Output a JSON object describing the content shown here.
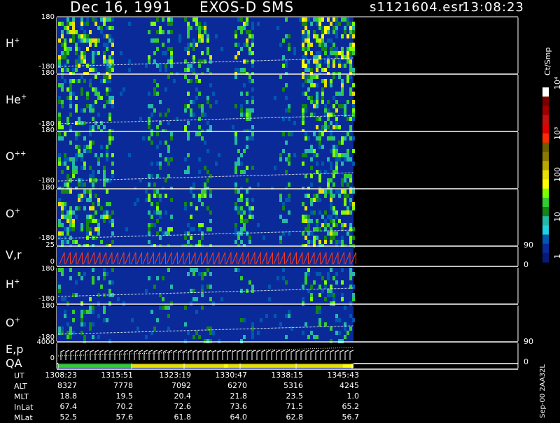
{
  "header": {
    "date": "Dec 16, 1991",
    "instrument": "EXOS-D SMS",
    "file": "s1121604.esr",
    "time": "13:08:23"
  },
  "colorbar": {
    "unit_label": "Ct/Smp",
    "ticks": [
      "10⁴",
      "10³",
      "100",
      "10",
      "1"
    ],
    "colors": [
      "#ffffff",
      "#7a0000",
      "#a00000",
      "#c01010",
      "#e00000",
      "#ff2a00",
      "#6b5d00",
      "#8a7a00",
      "#b8a800",
      "#e8e000",
      "#ffff00",
      "#7cff00",
      "#33cc33",
      "#158515",
      "#25b8a8",
      "#20d0e0",
      "#0058b0",
      "#0a2a9a",
      "#061a7a"
    ],
    "colors_role": "colour scale from top (high counts) to bottom (low counts)"
  },
  "panels": [
    {
      "id": "h_plus_1",
      "label": "H",
      "sup": "+",
      "ymax": "180",
      "ymin": "-180"
    },
    {
      "id": "he_plus",
      "label": "He",
      "sup": "+",
      "ymax": "180",
      "ymin": "-180"
    },
    {
      "id": "o_plusplus",
      "label": "O",
      "sup": "++",
      "ymax": "180",
      "ymin": "-180"
    },
    {
      "id": "o_plus_1",
      "label": "O",
      "sup": "+",
      "ymax": "180",
      "ymin": "-180"
    },
    {
      "id": "vr",
      "label": "V,r",
      "ymax": "25",
      "ymin": "0",
      "rmax": "90",
      "rmin": "0"
    },
    {
      "id": "h_plus_2",
      "label": "H",
      "sup": "+",
      "ymax": "180",
      "ymin": "-180"
    },
    {
      "id": "o_plus_2",
      "label": "O",
      "sup": "+",
      "ymax": "180",
      "ymin": "-180"
    },
    {
      "id": "ep",
      "label": "E,p",
      "ymax": "4000",
      "ymin": "0",
      "rmax": "90",
      "rmin": "0"
    },
    {
      "id": "qa",
      "label": "QA"
    }
  ],
  "side_note": "Sep-00  2AA32L",
  "table": {
    "row_labels": [
      "UT",
      "ALT",
      "MLT",
      "InLat",
      "MLat"
    ],
    "columns": [
      [
        "1308:23",
        "8327",
        "18.8",
        "67.4",
        "52.5"
      ],
      [
        "1315:51",
        "7778",
        "19.5",
        "70.2",
        "57.6"
      ],
      [
        "1323:19",
        "7092",
        "20.4",
        "72.6",
        "61.8"
      ],
      [
        "1330:47",
        "6270",
        "21.8",
        "73.6",
        "64.0"
      ],
      [
        "1338:15",
        "5316",
        "23.5",
        "71.5",
        "62.8"
      ],
      [
        "1345:43",
        "4245",
        "1.0",
        "65.2",
        "56.7"
      ]
    ]
  },
  "chart_data": {
    "type": "heatmap",
    "x": [
      "1308:23",
      "1315:51",
      "1323:19",
      "1330:47",
      "1338:15",
      "1345:43"
    ],
    "data_end": "1345:43",
    "panels": [
      "H+",
      "He+",
      "O++",
      "O+",
      "V,r",
      "H+",
      "O+",
      "E,p",
      "QA"
    ],
    "ylim_pitch": [
      -180,
      180
    ],
    "ylim_vr": [
      0,
      25
    ],
    "ylim_ep": [
      0,
      4000
    ],
    "colorscale_range": [
      1,
      10000
    ],
    "colorscale": "log",
    "activity_intervals": [
      "1308:23-1315:51",
      "1325:00-1328:30",
      "1331:00-1334:00",
      "1336:30-1337:30",
      "1339:00-1346:00"
    ]
  }
}
